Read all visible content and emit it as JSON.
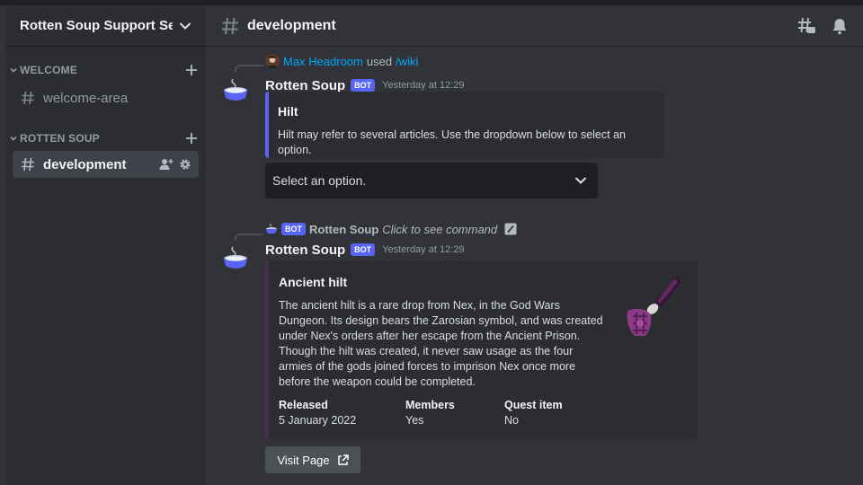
{
  "server": {
    "name": "Rotten Soup Support Se..."
  },
  "categories": [
    {
      "label": "WELCOME",
      "channels": [
        {
          "label": "welcome-area"
        }
      ]
    },
    {
      "label": "ROTTEN SOUP",
      "channels": [
        {
          "label": "development"
        }
      ]
    }
  ],
  "channel": {
    "title": "development"
  },
  "messages": [
    {
      "reply_user": "Max Headroom",
      "reply_used": "used",
      "reply_command": "/wiki",
      "author": "Rotten Soup",
      "bot_tag": "BOT",
      "timestamp": "Yesterday at 12:29",
      "embed": {
        "title": "Hilt",
        "description": "Hilt may refer to several articles. Use the dropdown below to select an option.",
        "color": "#5865f2"
      },
      "select": {
        "placeholder": "Select an option."
      }
    },
    {
      "reply_bot_tag": "BOT",
      "reply_user": "Rotten Soup",
      "reply_command": "Click to see command",
      "author": "Rotten Soup",
      "bot_tag": "BOT",
      "timestamp": "Yesterday at 12:29",
      "embed": {
        "title": "Ancient hilt",
        "description": "The ancient hilt is a rare drop from Nex, in the God Wars Dungeon. Its design bears the Zarosian symbol, and was created under Nex's orders after her escape from the Ancient Prison. Though the hilt was created, it never saw usage as the four armies of the gods joined forces to imprison Nex once more before the weapon could be completed.",
        "color": "#4a2e4a",
        "fields": [
          {
            "name": "Released",
            "value": "5 January 2022"
          },
          {
            "name": "Members",
            "value": "Yes"
          },
          {
            "name": "Quest item",
            "value": "No"
          }
        ]
      },
      "button": {
        "label": "Visit Page"
      }
    }
  ],
  "colors": {
    "link": "#00a8fc",
    "blurple": "#5865f2",
    "bg": "#313338",
    "sidebar": "#2b2d31"
  }
}
